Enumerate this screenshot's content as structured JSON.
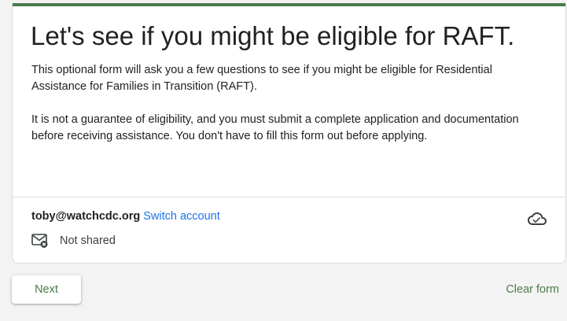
{
  "form": {
    "title": "Let's see if you might be eligible for RAFT.",
    "description_paragraphs": [
      "This optional form will ask you a few questions to see if you might be eligible for Residential Assistance for Families in Transition (RAFT).",
      "It is not a guarantee of eligibility, and you must submit a complete application and documentation before receiving assistance. You don't have to fill this form out before applying."
    ],
    "accent_color": "#4a7b4a"
  },
  "account": {
    "email": "toby@watchcdc.org",
    "switch_label": "Switch account",
    "shared_status": "Not shared",
    "cloud_icon": "cloud-check-icon",
    "mail_icon": "mail-not-shared-icon"
  },
  "actions": {
    "next_label": "Next",
    "clear_label": "Clear form"
  }
}
